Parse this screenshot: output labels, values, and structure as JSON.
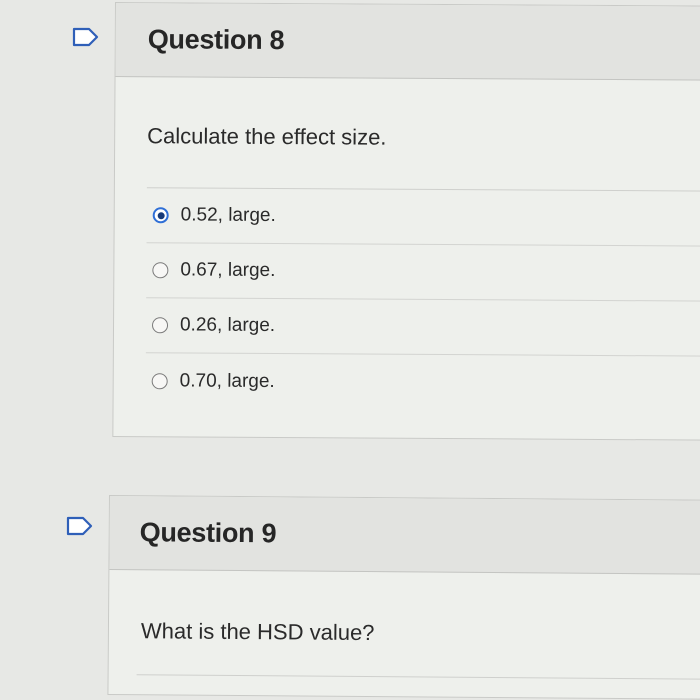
{
  "questions": [
    {
      "title": "Question 8",
      "prompt": "Calculate the effect size.",
      "answers": [
        {
          "label": "0.52, large.",
          "selected": true
        },
        {
          "label": "0.67, large.",
          "selected": false
        },
        {
          "label": "0.26, large.",
          "selected": false
        },
        {
          "label": "0.70, large.",
          "selected": false
        }
      ]
    },
    {
      "title": "Question 9",
      "prompt": "What is the HSD value?"
    }
  ],
  "icons": {
    "flag": "flag-outline-icon"
  },
  "colors": {
    "radio_selected_ring": "#2f6fd6",
    "radio_selected_dot": "#173a78",
    "flag_stroke": "#2f5fb8"
  }
}
